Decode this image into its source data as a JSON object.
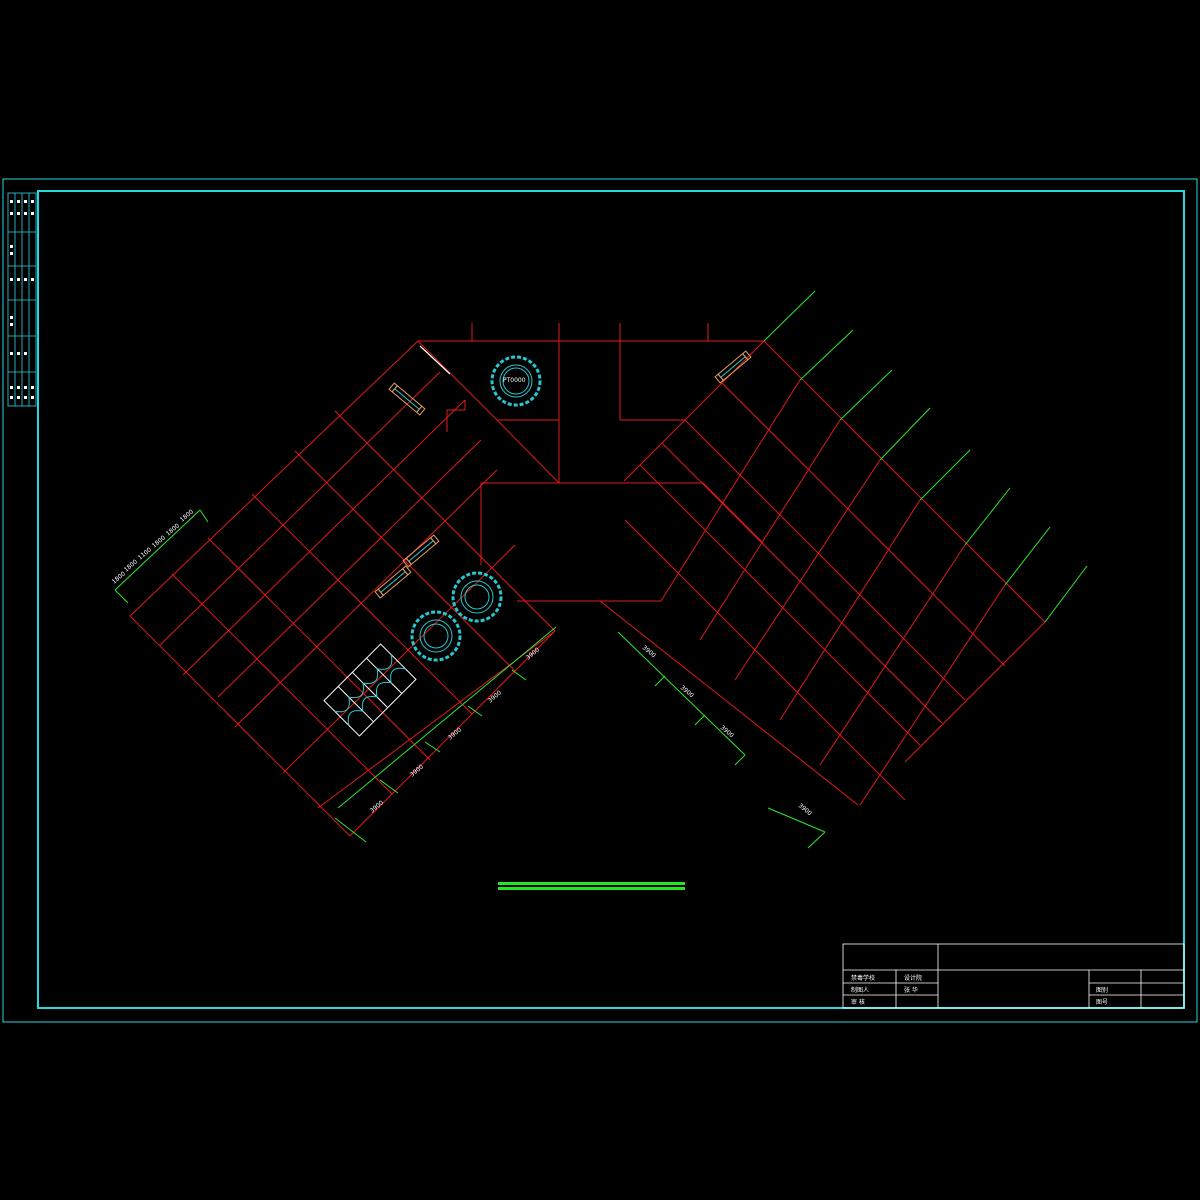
{
  "colors": {
    "background": "#000000",
    "frame": "#27d8e0",
    "grid_red": "#e01a1a",
    "dimension_green": "#2ee82e",
    "text": "#ffffff",
    "furniture_orange": "#e8a060",
    "furniture_cyan": "#27c8d0",
    "scale_bar": "#22e622"
  },
  "left_wing_dimensions": [
    "3900",
    "3900",
    "3900",
    "3900",
    "3900"
  ],
  "right_wing_dimensions": [
    "3900",
    "3900",
    "3900",
    "3900"
  ],
  "top_left_dimensions": [
    "1800",
    "1800",
    "1100",
    "1800",
    "1800",
    "1800"
  ],
  "round_table_label": "PT0000",
  "title_block": {
    "row1_col1": "禁毒学校",
    "row1_col2": "设计院",
    "row2_col1": "制图人",
    "row2_col2": "张 华",
    "row3_col1": "审 核",
    "scale_label": "图别",
    "sheet_label": "图号"
  }
}
